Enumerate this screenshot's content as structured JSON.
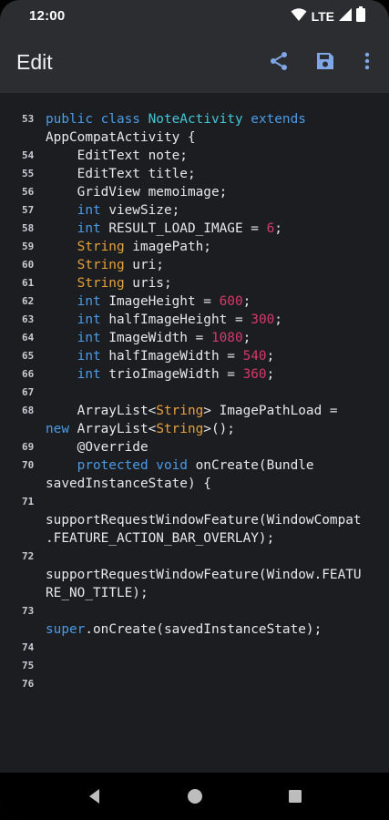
{
  "status_bar": {
    "time": "12:00",
    "network": "LTE",
    "icons": [
      "wifi-icon",
      "cell-signal-icon",
      "battery-icon"
    ]
  },
  "app_bar": {
    "title": "Edit",
    "actions": [
      "share-icon",
      "save-icon",
      "more-vert-icon"
    ]
  },
  "colors": {
    "keyword": "#4a9be8",
    "type": "#e8a13a",
    "number": "#d8386a",
    "class_name": "#3ec8d8",
    "text": "#e6e8ec",
    "background": "#1c1d20",
    "app_bar": "#2c2d31"
  },
  "editor": {
    "lines": [
      {
        "num": "53",
        "rows": [
          [
            [
              "kw",
              "public class "
            ],
            [
              "cls",
              "NoteActivity "
            ],
            [
              "kw",
              "extends"
            ]
          ],
          [
            [
              "",
              "AppCompatActivity {"
            ]
          ]
        ]
      },
      {
        "num": "54",
        "rows": [
          [
            [
              "",
              "    EditText note;"
            ]
          ]
        ]
      },
      {
        "num": "55",
        "rows": [
          [
            [
              "",
              "    EditText title;"
            ]
          ]
        ]
      },
      {
        "num": "56",
        "rows": [
          [
            [
              "",
              "    GridView memoimage;"
            ]
          ]
        ]
      },
      {
        "num": "57",
        "rows": [
          [
            [
              "",
              "    "
            ],
            [
              "kw",
              "int"
            ],
            [
              "",
              " viewSize;"
            ]
          ]
        ]
      },
      {
        "num": "58",
        "rows": [
          [
            [
              "",
              "    "
            ],
            [
              "kw",
              "int"
            ],
            [
              "",
              " RESULT_LOAD_IMAGE = "
            ],
            [
              "nm",
              "6"
            ],
            [
              "",
              ";"
            ]
          ]
        ]
      },
      {
        "num": "59",
        "rows": [
          [
            [
              "",
              "    "
            ],
            [
              "ty",
              "String"
            ],
            [
              "",
              " imagePath;"
            ]
          ]
        ]
      },
      {
        "num": "60",
        "rows": [
          [
            [
              "",
              "    "
            ],
            [
              "ty",
              "String"
            ],
            [
              "",
              " uri;"
            ]
          ]
        ]
      },
      {
        "num": "61",
        "rows": [
          [
            [
              "",
              "    "
            ],
            [
              "ty",
              "String"
            ],
            [
              "",
              " uris;"
            ]
          ]
        ]
      },
      {
        "num": "62",
        "rows": [
          [
            [
              "",
              "    "
            ],
            [
              "kw",
              "int"
            ],
            [
              "",
              " ImageHeight = "
            ],
            [
              "nm",
              "600"
            ],
            [
              "",
              ";"
            ]
          ]
        ]
      },
      {
        "num": "63",
        "rows": [
          [
            [
              "",
              "    "
            ],
            [
              "kw",
              "int"
            ],
            [
              "",
              " halfImageHeight = "
            ],
            [
              "nm",
              "300"
            ],
            [
              "",
              ";"
            ]
          ]
        ]
      },
      {
        "num": "64",
        "rows": [
          [
            [
              "",
              "    "
            ],
            [
              "kw",
              "int"
            ],
            [
              "",
              " ImageWidth = "
            ],
            [
              "nm",
              "1080"
            ],
            [
              "",
              ";"
            ]
          ]
        ]
      },
      {
        "num": "65",
        "rows": [
          [
            [
              "",
              "    "
            ],
            [
              "kw",
              "int"
            ],
            [
              "",
              " halfImageWidth = "
            ],
            [
              "nm",
              "540"
            ],
            [
              "",
              ";"
            ]
          ]
        ]
      },
      {
        "num": "66",
        "rows": [
          [
            [
              "",
              "    "
            ],
            [
              "kw",
              "int"
            ],
            [
              "",
              " trioImageWidth = "
            ],
            [
              "nm",
              "360"
            ],
            [
              "",
              ";"
            ]
          ]
        ]
      },
      {
        "num": "67",
        "rows": [
          [
            [
              "",
              ""
            ]
          ]
        ]
      },
      {
        "num": "68",
        "rows": [
          [
            [
              "",
              "    ArrayList<"
            ],
            [
              "ty",
              "String"
            ],
            [
              "",
              "> ImagePathLoad ="
            ]
          ],
          [
            [
              "kw",
              "new"
            ],
            [
              "",
              " ArrayList<"
            ],
            [
              "ty",
              "String"
            ],
            [
              "",
              ">();"
            ]
          ]
        ]
      },
      {
        "num": "69",
        "rows": [
          [
            [
              "",
              "    @Override"
            ]
          ]
        ]
      },
      {
        "num": "70",
        "rows": [
          [
            [
              "",
              "    "
            ],
            [
              "kw",
              "protected void"
            ],
            [
              "",
              " onCreate(Bundle"
            ]
          ],
          [
            [
              "",
              "savedInstanceState) {"
            ]
          ]
        ]
      },
      {
        "num": "71",
        "rows": [
          [
            [
              "",
              ""
            ]
          ],
          [
            [
              "",
              "supportRequestWindowFeature(WindowCompat"
            ]
          ],
          [
            [
              "",
              ".FEATURE_ACTION_BAR_OVERLAY);"
            ]
          ]
        ]
      },
      {
        "num": "72",
        "rows": [
          [
            [
              "",
              ""
            ]
          ],
          [
            [
              "",
              "supportRequestWindowFeature(Window.FEATU"
            ]
          ],
          [
            [
              "",
              "RE_NO_TITLE);"
            ]
          ]
        ]
      },
      {
        "num": "73",
        "rows": [
          [
            [
              "",
              ""
            ]
          ],
          [
            [
              "kw",
              "super"
            ],
            [
              "",
              ".onCreate(savedInstanceState);"
            ]
          ]
        ]
      },
      {
        "num": "74",
        "rows": [
          [
            [
              "",
              ""
            ]
          ]
        ]
      },
      {
        "num": "75",
        "rows": [
          [
            [
              "",
              ""
            ]
          ]
        ]
      },
      {
        "num": "76",
        "rows": [
          [
            [
              "",
              ""
            ]
          ]
        ]
      }
    ]
  },
  "nav_bar": {
    "buttons": [
      "back-icon",
      "home-icon",
      "recents-icon"
    ]
  }
}
